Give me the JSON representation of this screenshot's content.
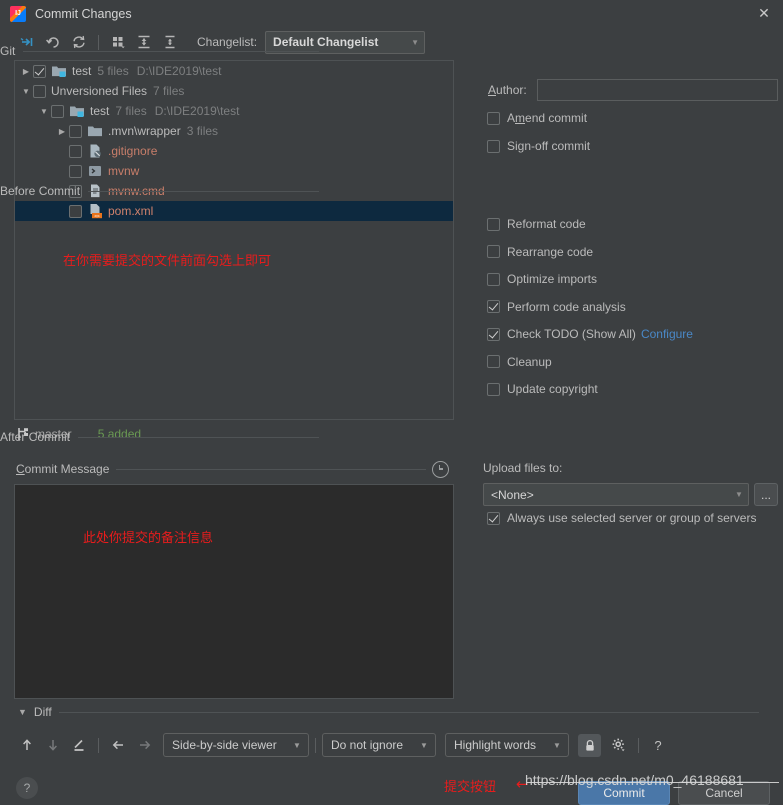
{
  "window": {
    "title": "Commit Changes",
    "app_icon": "intellij-idea-icon",
    "close_label": "✕"
  },
  "toolbar": {
    "changelist_label": "Changelist:",
    "changelist_value": "Default Changelist",
    "buttons": [
      {
        "name": "show-diff-icon",
        "title": "Show Diff"
      },
      {
        "name": "rollback-icon",
        "title": "Rollback"
      },
      {
        "name": "refresh-icon",
        "title": "Refresh"
      },
      {
        "name": "group-by-icon",
        "title": "Group By"
      },
      {
        "name": "expand-all-icon",
        "title": "Expand All"
      },
      {
        "name": "collapse-all-icon",
        "title": "Collapse All"
      }
    ]
  },
  "tree": {
    "rows": [
      {
        "indent": 0,
        "twisty": "collapsed",
        "checkbox": "checked",
        "icon": "module-folder-icon",
        "name": "test",
        "modified": false,
        "meta": "5 files",
        "path": "D:\\IDE2019\\test",
        "selected": false
      },
      {
        "indent": 0,
        "twisty": "expanded",
        "checkbox": "unchecked",
        "icon": "none",
        "name": "Unversioned Files",
        "modified": false,
        "meta": "7 files",
        "path": "",
        "selected": false
      },
      {
        "indent": 1,
        "twisty": "expanded",
        "checkbox": "unchecked",
        "icon": "module-folder-icon",
        "name": "test",
        "modified": false,
        "meta": "7 files",
        "path": "D:\\IDE2019\\test",
        "selected": false
      },
      {
        "indent": 2,
        "twisty": "collapsed",
        "checkbox": "unchecked",
        "icon": "folder-icon",
        "name": ".mvn\\wrapper",
        "modified": false,
        "meta": "3 files",
        "path": "",
        "selected": false
      },
      {
        "indent": 2,
        "twisty": "none",
        "checkbox": "unchecked",
        "icon": "gitignore-file-icon",
        "name": ".gitignore",
        "modified": true,
        "meta": "",
        "path": "",
        "selected": false
      },
      {
        "indent": 2,
        "twisty": "none",
        "checkbox": "unchecked",
        "icon": "shell-script-icon",
        "name": "mvnw",
        "modified": true,
        "meta": "",
        "path": "",
        "selected": false
      },
      {
        "indent": 2,
        "twisty": "none",
        "checkbox": "unchecked",
        "icon": "cmd-file-icon",
        "name": "mvnw.cmd",
        "modified": true,
        "meta": "",
        "path": "",
        "selected": false
      },
      {
        "indent": 2,
        "twisty": "none",
        "checkbox": "unchecked",
        "icon": "maven-xml-icon",
        "name": "pom.xml",
        "modified": true,
        "meta": "",
        "path": "",
        "selected": true
      }
    ],
    "annotation": "在你需要提交的文件前面勾选上即可"
  },
  "branch": {
    "icon": "git-branch-icon",
    "name": "master",
    "status": "5 added",
    "status_color": "#6a9a53"
  },
  "commit_message": {
    "title": "Commit Message",
    "value": "",
    "history_icon": "clock-history-icon",
    "annotation": "此处你提交的备注信息"
  },
  "diff": {
    "title": "Diff",
    "toggle": "expanded",
    "buttons": [
      {
        "name": "previous-difference-icon",
        "glyph": "↑",
        "dim": false
      },
      {
        "name": "next-difference-icon",
        "glyph": "↓",
        "dim": true
      },
      {
        "name": "annotate-icon",
        "glyph": "╱",
        "dim": false
      },
      {
        "name": "previous-file-icon",
        "glyph": "←",
        "dim": false
      },
      {
        "name": "next-file-icon",
        "glyph": "→",
        "dim": true
      }
    ],
    "viewer_mode": "Side-by-side viewer",
    "ignore_mode": "Do not ignore",
    "highlight_mode": "Highlight words",
    "lock_icon": "lock-icon",
    "settings_icon": "gear-icon",
    "help_icon": "question-mark-icon"
  },
  "git_section": {
    "title": "Git",
    "author_label": "Author:",
    "author_value": "",
    "amend_label": "Amend commit",
    "amend_checked": false,
    "signoff_label": "Sign-off commit",
    "signoff_checked": false
  },
  "before_commit": {
    "title": "Before Commit",
    "items": [
      {
        "label": "Reformat code",
        "checked": false,
        "link": ""
      },
      {
        "label": "Rearrange code",
        "checked": false,
        "link": ""
      },
      {
        "label": "Optimize imports",
        "checked": false,
        "link": ""
      },
      {
        "label": "Perform code analysis",
        "checked": true,
        "link": ""
      },
      {
        "label": "Check TODO (Show All)",
        "checked": true,
        "link": "Configure"
      },
      {
        "label": "Cleanup",
        "checked": false,
        "link": ""
      },
      {
        "label": "Update copyright",
        "checked": false,
        "link": ""
      }
    ]
  },
  "after_commit": {
    "title": "After Commit",
    "upload_label": "Upload files to:",
    "upload_value": "<None>",
    "browse_label": "...",
    "always_use_label": "Always use selected server or group of servers",
    "always_use_checked": true
  },
  "footer": {
    "help_label": "?",
    "commit_label": "Commit",
    "cancel_label": "Cancel",
    "annotation": "提交按钮",
    "arrow": "←",
    "watermark": "https://blog.csdn.net/m0_46188681"
  },
  "colors": {
    "accent_link": "#4a88c7",
    "primary_button": "#4a77a8",
    "annotation_red": "#e81c1c",
    "added_green": "#6a9a53",
    "modified_file": "#c87e6a",
    "selection": "#0d293f"
  }
}
